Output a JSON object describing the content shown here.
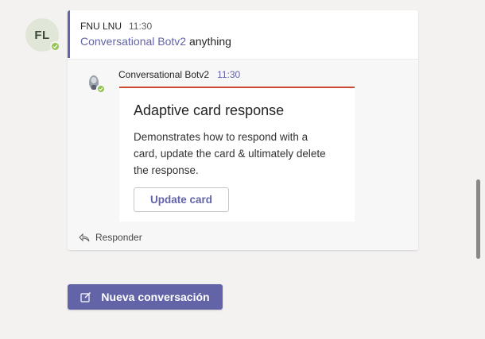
{
  "author": {
    "initials": "FL",
    "name": "FNU LNU",
    "time": "11:30"
  },
  "message": {
    "mention": "Conversational Botv2",
    "text": " anything"
  },
  "reply": {
    "author": "Conversational Botv2",
    "time": "11:30"
  },
  "card": {
    "title": "Adaptive card response",
    "text": "Demonstrates how to respond with a card, update the card & ultimately delete the response.",
    "button_label": "Update card"
  },
  "reply_link_label": "Responder",
  "new_conversation_label": "Nueva conversación",
  "colors": {
    "brand": "#6264a7",
    "presence": "#92c353",
    "card_accent": "#cc4a31"
  },
  "icons": {
    "presence": "check-icon",
    "reply": "reply-arrow-icon",
    "compose": "compose-icon"
  }
}
